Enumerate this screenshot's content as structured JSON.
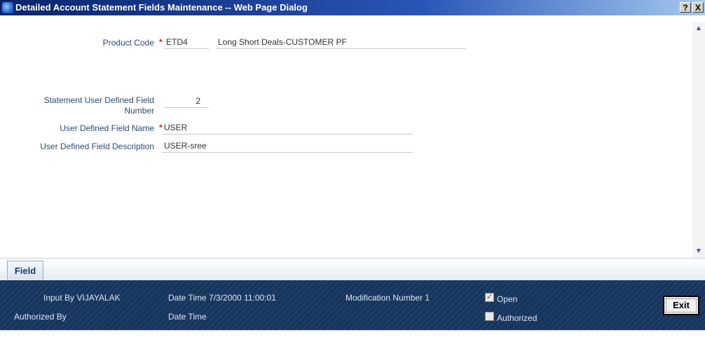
{
  "window": {
    "title": "Detailed Account Statement Fields Maintenance -- Web Page Dialog",
    "help_label": "?",
    "close_label": "X"
  },
  "form": {
    "product_code": {
      "label": "Product Code",
      "value": "ETD4",
      "description": "Long Short Deals-CUSTOMER PF"
    },
    "udf_number": {
      "label_line1": "Statement User Defined Field",
      "label_line2": "Number",
      "value": "2"
    },
    "udf_name": {
      "label": "User Defined Field Name",
      "value": "USER"
    },
    "udf_description": {
      "label": "User Defined Field Description",
      "value": "USER-sree"
    },
    "required_marker": "*"
  },
  "scrollbar": {
    "up_glyph": "▲",
    "down_glyph": "▼"
  },
  "tabs": [
    {
      "label": "Field",
      "active": true
    }
  ],
  "footer": {
    "input_by": "Input By VIJAYALAK",
    "date_time_1": "Date Time 7/3/2000 11:00:01",
    "modification_number": "Modification Number 1",
    "open_label": "Open",
    "open_checked": true,
    "authorized_by": "Authorized By",
    "date_time_2": "Date Time",
    "authorized_label": "Authorized",
    "authorized_checked": false,
    "exit_label": "Exit"
  },
  "colors": {
    "title_bar": "#0a246a",
    "label_text": "#2b4a7a",
    "required_marker": "#e02020",
    "footer_bg": "#16355e"
  }
}
